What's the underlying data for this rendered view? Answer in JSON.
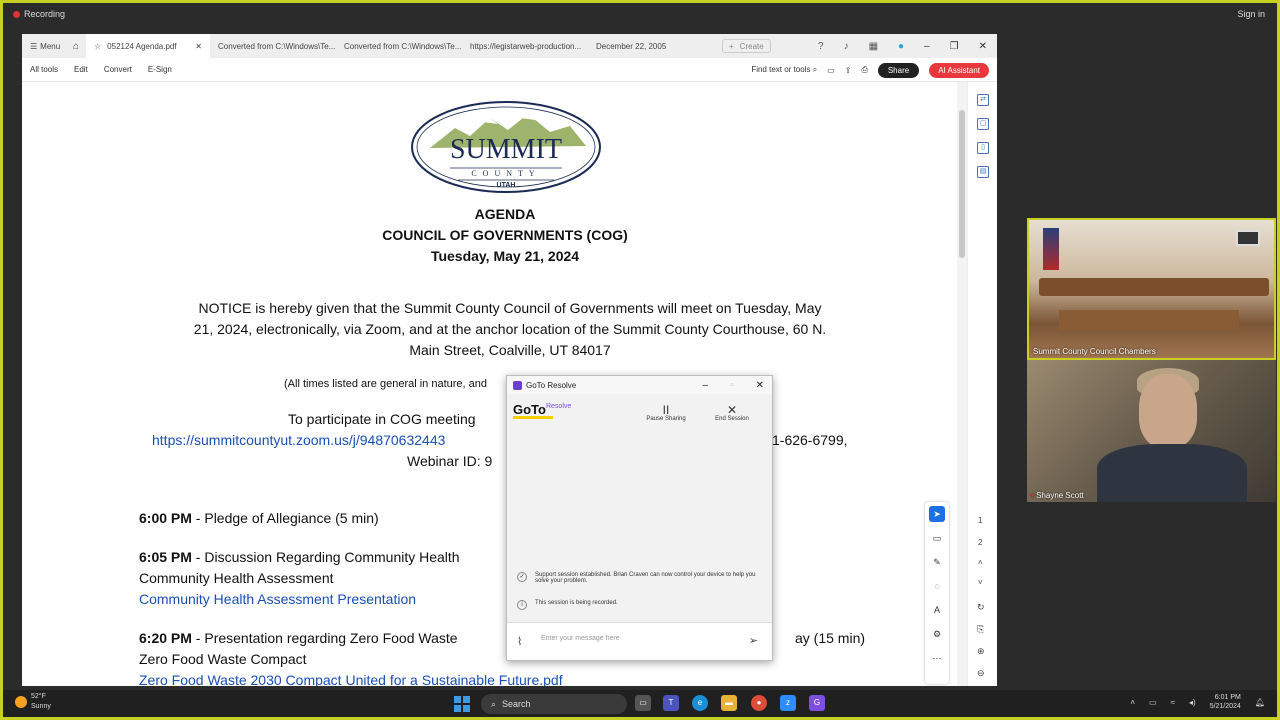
{
  "recording": {
    "label": "Recording",
    "signin": "Sign in"
  },
  "acrobat": {
    "menu": "Menu",
    "tabs": [
      {
        "label": "052124 Agenda.pdf"
      },
      {
        "label": "Converted from C:\\Windows\\Te..."
      },
      {
        "label": "Converted from C:\\Windows\\Te..."
      },
      {
        "label": "https://legistarweb-production..."
      },
      {
        "label": "December 22, 2005"
      }
    ],
    "create": "Create",
    "toolbar": {
      "all_tools": "All tools",
      "edit": "Edit",
      "convert": "Convert",
      "esign": "E-Sign",
      "find": "Find text or tools",
      "share": "Share",
      "ai": "AI Assistant"
    },
    "page_numbers": [
      "1",
      "2"
    ]
  },
  "document": {
    "logo": {
      "line1": "SUMMIT",
      "line2": "COUNTY",
      "line3": "UTAH"
    },
    "heading1": "AGENDA",
    "heading2": "COUNCIL OF GOVERNMENTS (COG)",
    "heading3": "Tuesday, May 21, 2024",
    "notice_line1": "NOTICE is hereby given that the Summit County Council of Governments will meet on  Tuesday, May",
    "notice_line2": "21, 2024, electronically, via Zoom, and at the anchor location of the Summit County Courthouse, 60 N.",
    "notice_line3": "Main Street, Coalville, UT 84017",
    "times_note": "(All times listed are general in nature, and",
    "participate": "To participate in COG meeting",
    "zoom_link": "https://summitcountyut.zoom.us/j/94870632443",
    "phone": "1-626-6799,",
    "webinar": "Webinar ID: 9",
    "items": [
      {
        "time": "6:00 PM",
        "text": " - Pledge of Allegiance (5 min)"
      },
      {
        "time": "6:05 PM",
        "text": " - Discussion Regarding Community Health",
        "line2": "Community Health Assessment",
        "link": "Community Health Assessment Presentation"
      },
      {
        "time": "6:20 PM",
        "text": " - Presentation regarding Zero Food Waste",
        "tail": "ay  (15 min)",
        "line2": "Zero Food Waste Compact",
        "link": "Zero Food Waste 2030 Compact United for a Sustainable Future.pdf"
      }
    ]
  },
  "goto": {
    "title": "GoTo Resolve",
    "brand": "GoTo",
    "brand_sub": "Resolve",
    "pause": "Pause Sharing",
    "end": "End Session",
    "msg1": "Support session established. Brian Craven can now control your device to help you solve your problem.",
    "msg2": "This session is being recorded.",
    "input_placeholder": "Enter your message here"
  },
  "video": {
    "room_label": "Summit County Council Chambers",
    "person_label": "Shayne Scott"
  },
  "taskbar": {
    "weather_temp": "52°F",
    "weather_cond": "Sunny",
    "search": "Search",
    "time": "6:01 PM",
    "date": "5/21/2024"
  }
}
